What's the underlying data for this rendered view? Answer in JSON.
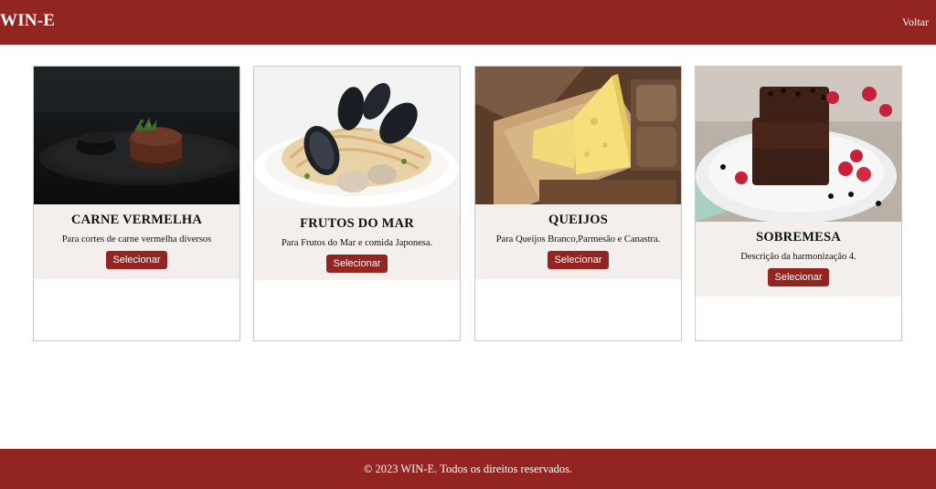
{
  "header": {
    "brand": "WIN-E",
    "back_label": "Voltar"
  },
  "cards": [
    {
      "title": "CARNE VERMELHA",
      "description": "Para cortes de carne vermelha diversos",
      "button_label": "Selecionar",
      "image": "steak-photo"
    },
    {
      "title": "FRUTOS DO MAR",
      "description": "Para Frutos do Mar e comida Japonesa.",
      "button_label": "Selecionar",
      "image": "seafood-pasta-photo"
    },
    {
      "title": "QUEIJOS",
      "description": "Para Queijos Branco,Parmesão e Canastra.",
      "button_label": "Selecionar",
      "image": "cheese-board-photo"
    },
    {
      "title": "SOBREMESA",
      "description": "Descrição da harmonização 4.",
      "button_label": "Selecionar",
      "image": "brownie-photo"
    }
  ],
  "footer": {
    "text": "© 2023 WIN-E. Todos os direitos reservados."
  },
  "colors": {
    "brand_red": "#922421",
    "card_body_bg": "#f4efed"
  }
}
